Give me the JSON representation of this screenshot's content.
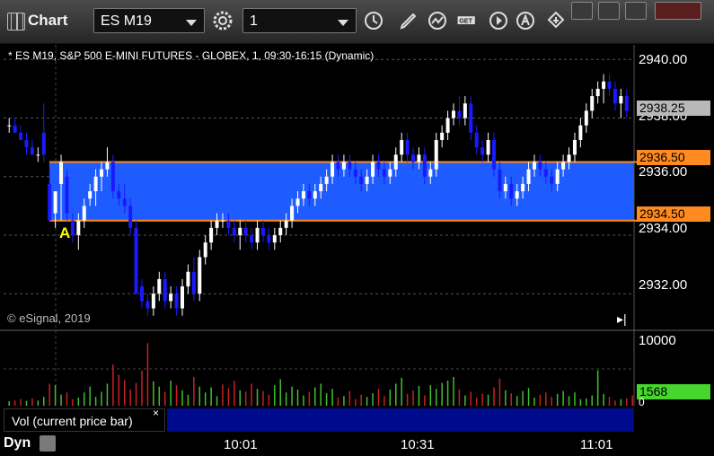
{
  "window": {
    "title": "Chart"
  },
  "toolbar": {
    "symbol": "ES M19",
    "interval": "1",
    "icons": [
      "settings-gear-icon",
      "clock-icon",
      "pencil-icon",
      "line-study-icon",
      "get-data-icon",
      "play-icon",
      "alert-icon",
      "link-icon"
    ]
  },
  "window_controls": [
    "restore-icon",
    "minimize-icon",
    "maximize-icon",
    "close-icon"
  ],
  "chart": {
    "header": "* ES M19, S&P 500 E-MINI FUTURES - GLOBEX, 1, 09:30-16:15 (Dynamic)",
    "copyright": "© eSignal, 2019",
    "marker_label": "A",
    "price_axis_labels": [
      "2940.00",
      "2938.00",
      "2936.00",
      "2934.00",
      "2932.00"
    ],
    "current_price": "2938.25",
    "zone_top_price": "2936.50",
    "zone_bottom_price": "2934.50",
    "volume_axis_top": "10000",
    "volume_axis_bottom": "0",
    "current_volume": "1568",
    "pane_label": "Vol (current price bar)",
    "pane_close": "×",
    "time_labels": [
      "10:01",
      "10:31",
      "11:01"
    ],
    "mode_label": "Dyn",
    "colors": {
      "up": "#ffffff",
      "down": "#1a1aff",
      "zone": "#1f5cff",
      "zone_line": "#ff8a1f",
      "vol_up": "#3fbf2f",
      "vol_down": "#c82020",
      "current_price_tag": "#b8b8b8",
      "volume_tag": "#46d62d"
    }
  },
  "chart_data": {
    "type": "candlestick",
    "title": "* ES M19, S&P 500 E-MINI FUTURES - GLOBEX, 1, 09:30-16:15 (Dynamic)",
    "ylim": [
      2930.75,
      2940.5
    ],
    "y_ticks": [
      2932.0,
      2934.0,
      2936.0,
      2938.0,
      2940.0
    ],
    "x_ticks": [
      "10:01",
      "10:31",
      "11:01"
    ],
    "zone": {
      "top": 2936.5,
      "bottom": 2934.5
    },
    "current_price": 2938.25,
    "volume_ylim": [
      0,
      10000
    ],
    "current_volume": 1568,
    "ohlc": [
      [
        2937.75,
        2938.0,
        2937.5,
        2937.75
      ],
      [
        2937.75,
        2938.0,
        2937.5,
        2937.5
      ],
      [
        2937.5,
        2937.75,
        2937.25,
        2937.25
      ],
      [
        2937.25,
        2937.5,
        2936.75,
        2937.0
      ],
      [
        2937.0,
        2937.25,
        2936.75,
        2936.75
      ],
      [
        2936.75,
        2937.0,
        2936.5,
        2936.75
      ],
      [
        2937.5,
        2938.5,
        2936.5,
        2936.75
      ],
      [
        2935.75,
        2936.25,
        2934.75,
        2934.5
      ],
      [
        2934.75,
        2935.5,
        2934.25,
        2935.5
      ],
      [
        2935.75,
        2936.75,
        2934.5,
        2936.5
      ],
      [
        2936.0,
        2936.25,
        2934.5,
        2934.75
      ],
      [
        2934.5,
        2934.75,
        2933.75,
        2934.0
      ],
      [
        2934.0,
        2934.75,
        2933.5,
        2934.5
      ],
      [
        2934.5,
        2935.25,
        2934.25,
        2935.0
      ],
      [
        2935.25,
        2935.75,
        2935.0,
        2935.5
      ],
      [
        2935.5,
        2936.25,
        2935.0,
        2936.0
      ],
      [
        2936.0,
        2936.5,
        2935.5,
        2936.25
      ],
      [
        2936.25,
        2937.0,
        2936.0,
        2936.5
      ],
      [
        2936.5,
        2936.75,
        2935.25,
        2935.5
      ],
      [
        2935.5,
        2935.75,
        2935.0,
        2935.25
      ],
      [
        2935.25,
        2935.75,
        2934.75,
        2935.0
      ],
      [
        2935.0,
        2935.25,
        2934.0,
        2934.25
      ],
      [
        2934.25,
        2934.5,
        2932.25,
        2932.0
      ],
      [
        2932.25,
        2932.5,
        2931.5,
        2931.75
      ],
      [
        2931.75,
        2932.0,
        2931.25,
        2931.5
      ],
      [
        2931.5,
        2932.25,
        2931.25,
        2932.0
      ],
      [
        2932.0,
        2932.75,
        2931.75,
        2932.5
      ],
      [
        2932.5,
        2932.75,
        2931.5,
        2931.75
      ],
      [
        2931.75,
        2932.25,
        2931.5,
        2932.0
      ],
      [
        2932.0,
        2932.25,
        2931.25,
        2931.5
      ],
      [
        2931.5,
        2932.5,
        2931.25,
        2932.25
      ],
      [
        2932.25,
        2933.0,
        2932.0,
        2932.75
      ],
      [
        2932.75,
        2933.25,
        2931.75,
        2932.0
      ],
      [
        2932.0,
        2933.5,
        2931.75,
        2933.25
      ],
      [
        2933.25,
        2934.0,
        2933.0,
        2933.75
      ],
      [
        2933.75,
        2934.5,
        2933.5,
        2934.25
      ],
      [
        2934.25,
        2934.75,
        2934.0,
        2934.5
      ],
      [
        2934.5,
        2934.75,
        2934.25,
        2934.5
      ],
      [
        2934.5,
        2934.75,
        2934.0,
        2934.25
      ],
      [
        2934.25,
        2934.5,
        2933.75,
        2934.0
      ],
      [
        2934.0,
        2934.5,
        2933.5,
        2934.25
      ],
      [
        2934.25,
        2934.5,
        2933.75,
        2934.0
      ],
      [
        2934.0,
        2934.25,
        2933.5,
        2933.75
      ],
      [
        2933.75,
        2934.5,
        2933.5,
        2934.25
      ],
      [
        2934.25,
        2934.5,
        2933.75,
        2934.0
      ],
      [
        2934.0,
        2934.25,
        2933.5,
        2933.75
      ],
      [
        2933.75,
        2934.25,
        2933.5,
        2934.0
      ],
      [
        2934.0,
        2934.5,
        2933.75,
        2934.25
      ],
      [
        2934.25,
        2934.75,
        2934.0,
        2934.5
      ],
      [
        2934.5,
        2935.25,
        2934.25,
        2935.0
      ],
      [
        2935.0,
        2935.5,
        2934.75,
        2935.25
      ],
      [
        2935.25,
        2935.75,
        2935.0,
        2935.5
      ],
      [
        2935.5,
        2935.75,
        2935.0,
        2935.25
      ],
      [
        2935.25,
        2935.75,
        2935.0,
        2935.5
      ],
      [
        2935.5,
        2936.0,
        2935.25,
        2935.75
      ],
      [
        2935.75,
        2936.25,
        2935.5,
        2936.0
      ],
      [
        2936.0,
        2936.75,
        2935.75,
        2936.5
      ],
      [
        2936.5,
        2936.75,
        2936.0,
        2936.25
      ],
      [
        2936.25,
        2936.75,
        2936.0,
        2936.5
      ],
      [
        2936.5,
        2936.75,
        2936.0,
        2936.25
      ],
      [
        2936.25,
        2936.5,
        2935.75,
        2936.0
      ],
      [
        2936.0,
        2936.25,
        2935.5,
        2935.75
      ],
      [
        2935.75,
        2936.25,
        2935.5,
        2936.0
      ],
      [
        2936.0,
        2936.75,
        2935.75,
        2936.5
      ],
      [
        2936.5,
        2936.75,
        2936.0,
        2936.25
      ],
      [
        2936.25,
        2936.5,
        2935.75,
        2936.0
      ],
      [
        2936.0,
        2936.5,
        2935.75,
        2936.25
      ],
      [
        2936.25,
        2937.0,
        2936.0,
        2936.75
      ],
      [
        2936.75,
        2937.5,
        2936.5,
        2937.25
      ],
      [
        2937.25,
        2937.5,
        2936.5,
        2936.75
      ],
      [
        2936.75,
        2937.0,
        2936.25,
        2936.5
      ],
      [
        2936.5,
        2937.0,
        2936.25,
        2936.75
      ],
      [
        2936.75,
        2937.0,
        2935.75,
        2936.0
      ],
      [
        2936.0,
        2936.5,
        2935.75,
        2936.25
      ],
      [
        2936.25,
        2937.5,
        2936.0,
        2937.25
      ],
      [
        2937.25,
        2937.75,
        2937.0,
        2937.5
      ],
      [
        2937.5,
        2938.25,
        2937.25,
        2938.0
      ],
      [
        2938.0,
        2938.5,
        2937.75,
        2938.25
      ],
      [
        2938.25,
        2938.75,
        2937.75,
        2938.0
      ],
      [
        2938.0,
        2938.75,
        2937.75,
        2938.5
      ],
      [
        2938.5,
        2938.75,
        2937.25,
        2937.5
      ],
      [
        2937.5,
        2937.75,
        2936.75,
        2937.0
      ],
      [
        2937.0,
        2937.25,
        2936.5,
        2936.75
      ],
      [
        2936.75,
        2937.5,
        2936.5,
        2937.25
      ],
      [
        2937.25,
        2937.5,
        2936.0,
        2936.25
      ],
      [
        2936.25,
        2936.5,
        2935.25,
        2935.5
      ],
      [
        2935.5,
        2936.0,
        2935.25,
        2935.75
      ],
      [
        2935.75,
        2936.0,
        2935.0,
        2935.25
      ],
      [
        2935.25,
        2935.75,
        2935.0,
        2935.5
      ],
      [
        2935.5,
        2936.0,
        2935.25,
        2935.75
      ],
      [
        2935.75,
        2936.5,
        2935.5,
        2936.25
      ],
      [
        2936.25,
        2936.75,
        2936.0,
        2936.5
      ],
      [
        2936.5,
        2936.75,
        2936.0,
        2936.25
      ],
      [
        2936.25,
        2936.5,
        2935.75,
        2936.0
      ],
      [
        2936.0,
        2936.25,
        2935.5,
        2935.75
      ],
      [
        2935.75,
        2936.5,
        2935.5,
        2936.25
      ],
      [
        2936.25,
        2936.75,
        2936.0,
        2936.5
      ],
      [
        2936.5,
        2937.0,
        2936.25,
        2936.75
      ],
      [
        2936.75,
        2937.5,
        2936.5,
        2937.25
      ],
      [
        2937.25,
        2938.0,
        2937.0,
        2937.75
      ],
      [
        2937.75,
        2938.5,
        2937.5,
        2938.25
      ],
      [
        2938.25,
        2939.0,
        2938.0,
        2938.75
      ],
      [
        2938.75,
        2939.25,
        2938.5,
        2939.0
      ],
      [
        2939.0,
        2939.5,
        2938.5,
        2939.25
      ],
      [
        2939.25,
        2939.5,
        2938.75,
        2939.0
      ],
      [
        2939.0,
        2939.25,
        2938.25,
        2938.5
      ],
      [
        2938.5,
        2939.0,
        2938.0,
        2938.75
      ],
      [
        2938.75,
        2939.0,
        2938.0,
        2938.25
      ]
    ],
    "volume": [
      600,
      700,
      900,
      650,
      1000,
      700,
      1200,
      3000,
      2800,
      1500,
      1800,
      900,
      1100,
      1800,
      2600,
      1200,
      1900,
      3000,
      5600,
      4200,
      3500,
      2200,
      3100,
      4800,
      8500,
      3300,
      2600,
      1900,
      3400,
      2800,
      2100,
      1500,
      3900,
      2600,
      1800,
      2500,
      1300,
      2900,
      2400,
      3400,
      2100,
      1900,
      3000,
      2300,
      2000,
      1500,
      2800,
      3600,
      1800,
      2600,
      2200,
      1400,
      1900,
      2500,
      3000,
      1700,
      2300,
      1100,
      1300,
      2000,
      900,
      1500,
      1200,
      1700,
      2300,
      1300,
      2200,
      3000,
      3800,
      1600,
      2100,
      2700,
      1400,
      2800,
      2300,
      3100,
      3400,
      3900,
      2200,
      1400,
      1900,
      1100,
      1600,
      1500,
      2500,
      3700,
      2100,
      1700,
      1300,
      2000,
      2400,
      1100,
      1500,
      1800,
      1200,
      1600,
      2000,
      1300,
      1800,
      900,
      1000,
      1400,
      4800,
      1600,
      1200,
      700,
      900,
      1000,
      1400
    ],
    "volume_up": [
      true,
      false,
      false,
      true,
      false,
      true,
      true,
      false,
      true,
      true,
      false,
      false,
      true,
      true,
      true,
      true,
      true,
      true,
      false,
      false,
      false,
      false,
      false,
      false,
      false,
      true,
      true,
      false,
      true,
      false,
      true,
      true,
      false,
      true,
      true,
      true,
      true,
      false,
      false,
      false,
      true,
      false,
      false,
      true,
      false,
      false,
      true,
      true,
      true,
      true,
      true,
      true,
      false,
      true,
      true,
      true,
      true,
      false,
      true,
      false,
      false,
      false,
      true,
      true,
      false,
      false,
      true,
      true,
      true,
      false,
      false,
      true,
      false,
      true,
      true,
      true,
      true,
      true,
      false,
      true,
      false,
      false,
      false,
      true,
      false,
      false,
      true,
      false,
      true,
      true,
      true,
      true,
      false,
      false,
      false,
      true,
      true,
      true,
      true,
      true,
      true,
      true,
      true,
      true,
      false,
      false,
      true,
      false,
      false
    ]
  }
}
